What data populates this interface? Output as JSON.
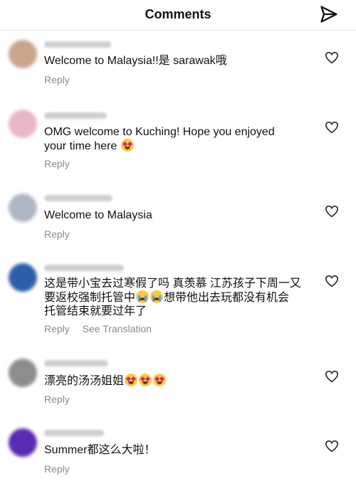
{
  "header": {
    "title": "Comments",
    "send_icon": "send-icon"
  },
  "comments": [
    {
      "text": "Welcome to Malaysia!!是 sarawak哦",
      "reply": "Reply",
      "avatar_color": "#caa58c"
    },
    {
      "text_lines": [
        "OMG welcome to Kuching! Hope you enjoyed",
        "your time here"
      ],
      "reply": "Reply",
      "avatar_color": "#e8b7c8"
    },
    {
      "text": "Welcome to Malaysia",
      "reply": "Reply",
      "avatar_color": "#aeb7c4"
    },
    {
      "text_lines": [
        "这是带小宝去过寒假了吗 真羡慕 江苏孩子下周一又",
        "要返校强制托管中",
        "想带他出去玩都没有机会",
        "托管结束就要过年了"
      ],
      "reply": "Reply",
      "see_translation": "See Translation",
      "avatar_color": "#2d5fa8"
    },
    {
      "text": "漂亮的汤汤姐姐",
      "reply": "Reply",
      "avatar_color": "#8d8d8d"
    },
    {
      "text": "Summer都这么大啦！",
      "reply": "Reply",
      "avatar_color": "#5a2bb3"
    }
  ]
}
